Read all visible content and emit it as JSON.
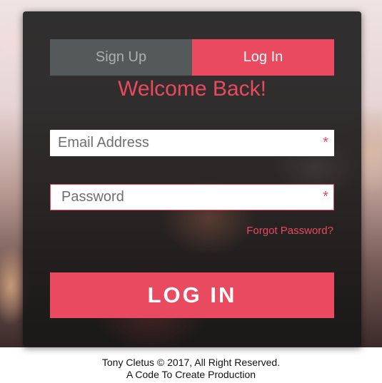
{
  "tabs": {
    "signup_label": "Sign Up",
    "login_label": "Log In",
    "active": "Log In"
  },
  "heading": "Welcome Back!",
  "form": {
    "email_placeholder": "Email Address",
    "email_value": "",
    "password_placeholder": "Password",
    "password_value": "",
    "required_marker": "*",
    "forgot_label": "Forgot Password?",
    "submit_label": "LOG IN"
  },
  "footer": {
    "line1": "Tony Cletus © 2017, All Right Reserved.",
    "line2": "A Code To Create Production"
  },
  "colors": {
    "accent": "#e94a5f",
    "tab_inactive": "#535a59",
    "panel": "#161616"
  }
}
